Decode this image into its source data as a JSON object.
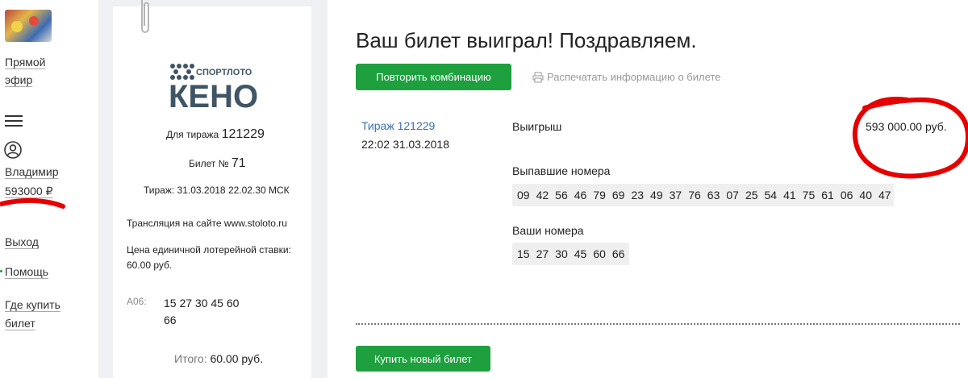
{
  "sidebar": {
    "live_label_line1": "Прямой",
    "live_label_line2": "эфир",
    "user_name": "Владимир",
    "balance": "593000 ₽",
    "logout": "Выход",
    "help": "Помощь",
    "where_to_buy_line1": "Где купить",
    "where_to_buy_line2": "билет"
  },
  "ticket": {
    "brand_small": "СПОРТЛОТО",
    "brand_big": "КЕНО",
    "draw_label": "Для тиража",
    "draw_number": "121229",
    "ticket_label": "Билет №",
    "ticket_number": "71",
    "draw_datetime": "Тираж: 31.03.2018 22.02.30 МСК",
    "broadcast": "Трансляция на сайте www.stoloto.ru",
    "price_line1": "Цена единичной лотерейной ставки:",
    "price_line2": "60.00 руб.",
    "combo_label": "А06:",
    "combo_line1": "15 27 30 45 60",
    "combo_line2": "66",
    "total_label": "Итого:",
    "total_value": "60.00 руб."
  },
  "main": {
    "title": "Ваш билет выиграл! Поздравляем.",
    "repeat_button": "Повторить комбинацию",
    "print_link": "Распечатать информацию о билете",
    "draw_link": "Тираж 121229",
    "draw_date": "22:02 31.03.2018",
    "winnings_label": "Выигрыш",
    "winnings_value": "593 000.00 руб.",
    "drawn_label": "Выпавшие номера",
    "drawn_numbers": [
      "09",
      "42",
      "56",
      "46",
      "79",
      "69",
      "23",
      "49",
      "37",
      "76",
      "63",
      "07",
      "25",
      "54",
      "41",
      "75",
      "61",
      "06",
      "40",
      "47"
    ],
    "your_label": "Ваши номера",
    "your_numbers": [
      "15",
      "27",
      "30",
      "45",
      "60",
      "66"
    ],
    "buy_button": "Купить новый билет"
  },
  "colors": {
    "green": "#1ea03f",
    "link_blue": "#3a6fb0",
    "annotation_red": "#e60000",
    "keno_dark": "#3f5566"
  }
}
